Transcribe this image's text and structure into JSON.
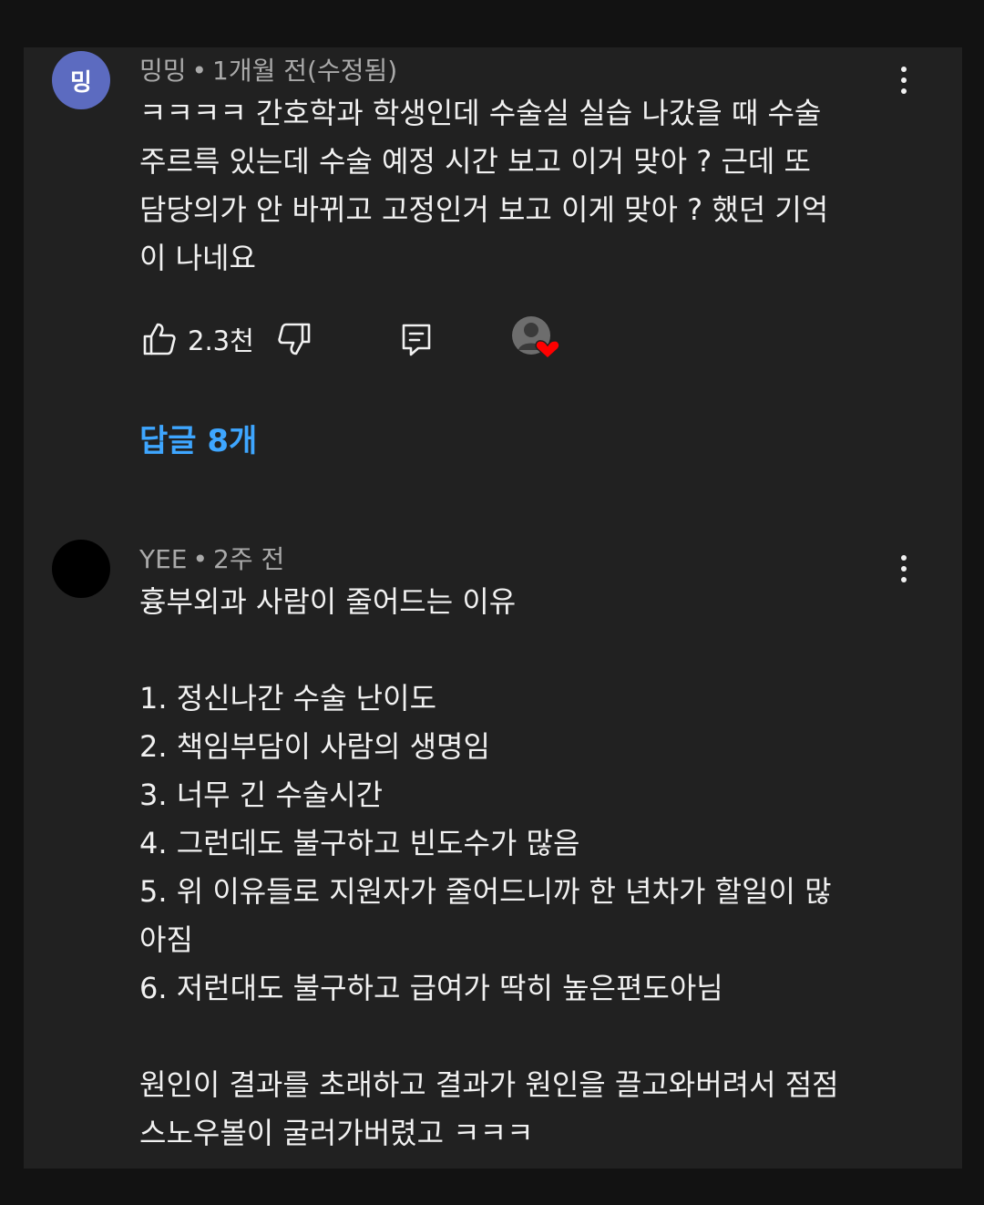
{
  "comments": [
    {
      "avatar_letter": "밍",
      "author": "밍밍",
      "time": "1개월 전(수정됨)",
      "lines": [
        "ㅋㅋㅋㅋ 간호학과 학생인데 수술실 실습 나갔을 때 수술",
        "주르륵 있는데 수술 예정 시간 보고 이거 맞아 ? 근데 또",
        "담당의가 안 바뀌고 고정인거 보고 이게 맞아 ? 했던 기억",
        "이 나네요"
      ],
      "like_count": "2.3천",
      "replies_label": "답글 8개"
    },
    {
      "author": "YEE",
      "time": "2주 전",
      "lines": [
        "흉부외과 사람이 줄어드는 이유",
        "",
        "1. 정신나간 수술 난이도",
        "2. 책임부담이 사람의 생명임",
        "3. 너무 긴 수술시간",
        "4. 그런데도 불구하고 빈도수가 많음",
        "5. 위 이유들로 지원자가 줄어드니까 한 년차가 할일이 많",
        "아짐",
        "6. 저런대도 불구하고 급여가 딱히 높은편도아님",
        "",
        "원인이 결과를 초래하고 결과가 원인을 끌고와버려서 점점",
        "스노우볼이 굴러가버렸고 ㅋㅋㅋ"
      ]
    }
  ],
  "separator": "•",
  "colors": {
    "background": "#212121",
    "text": "#f1f1f1",
    "meta": "#aaaaaa",
    "link": "#3ea6ff",
    "avatar": "#5c6bc0",
    "heart": "#ff0000"
  },
  "icons": [
    "thumbs-up-icon",
    "thumbs-down-icon",
    "reply-icon",
    "creator-heart-icon",
    "more-vert-icon"
  ]
}
